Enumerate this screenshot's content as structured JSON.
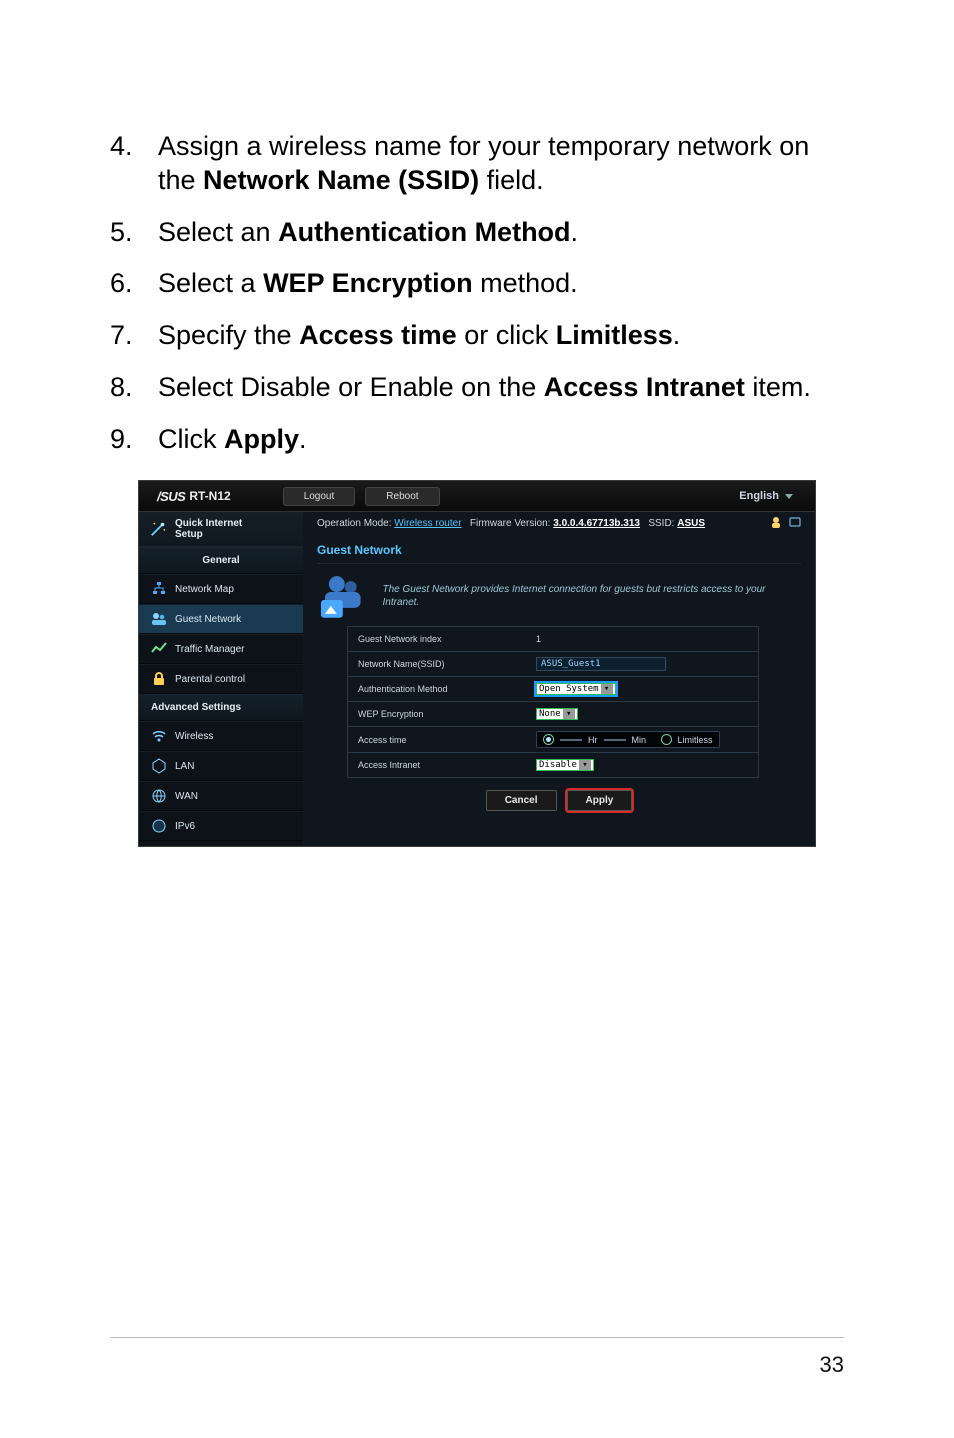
{
  "steps": [
    {
      "n": "4.",
      "t1": "Assign a wireless name for your temporary network on the ",
      "b": "Network Name (SSID)",
      "t2": " field."
    },
    {
      "n": "5.",
      "t1": "Select an ",
      "b": "Authentication Method",
      "t2": "."
    },
    {
      "n": "6.",
      "t1": "Select a ",
      "b": "WEP Encryption",
      "t2": " method."
    },
    {
      "n": "7.",
      "t1": "Specify the ",
      "b": "Access time",
      "t2": " or click ",
      "b2": "Limitless",
      "t3": "."
    },
    {
      "n": "8.",
      "t1": "Select Disable or Enable on the ",
      "b": "Access Intranet",
      "t2": " item."
    },
    {
      "n": "9.",
      "t1": "Click ",
      "b": "Apply",
      "t2": "."
    }
  ],
  "top": {
    "brand": "/SUS",
    "model": "RT-N12",
    "logout": "Logout",
    "reboot": "Reboot",
    "lang": "English"
  },
  "opline": {
    "opmode_k": "Operation Mode:",
    "opmode_v": "Wireless router",
    "fw_k": "Firmware Version:",
    "fw_v": "3.0.0.4.67713b.313",
    "ssid_k": "SSID:",
    "ssid_v": "ASUS"
  },
  "side": {
    "qis": "Quick Internet\nSetup",
    "general": "General",
    "items_general": [
      "Network Map",
      "Guest Network",
      "Traffic Manager",
      "Parental control"
    ],
    "advanced": "Advanced Settings",
    "items_adv": [
      "Wireless",
      "LAN",
      "WAN",
      "IPv6"
    ]
  },
  "sectionTitle": "Guest Network",
  "introText": "The Guest Network provides Internet connection for guests but restricts access to your Intranet.",
  "rows": {
    "idx_l": "Guest Network index",
    "idx_v": "1",
    "ssid_l": "Network Name(SSID)",
    "ssid_v": "ASUS_Guest1",
    "auth_l": "Authentication Method",
    "auth_v": "Open System",
    "wep_l": "WEP Encryption",
    "wep_v": "None",
    "time_l": "Access time",
    "time_hr_lbl": "Hr",
    "time_min_lbl": "Min",
    "time_limitless": "Limitless",
    "intr_l": "Access Intranet",
    "intr_v": "Disable"
  },
  "buttons": {
    "cancel": "Cancel",
    "apply": "Apply"
  },
  "pagenum": "33"
}
